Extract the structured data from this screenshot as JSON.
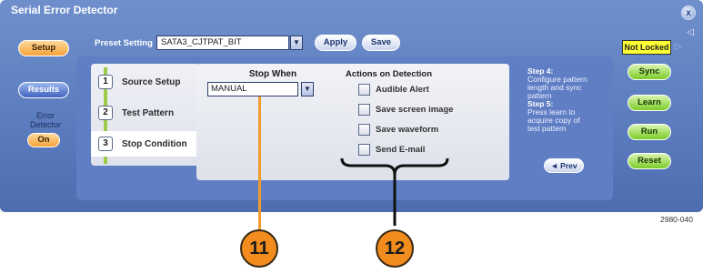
{
  "window": {
    "title": "Serial Error Detector",
    "close_glyph": "x"
  },
  "left_nav": {
    "setup_label": "Setup",
    "results_label": "Results",
    "error_detector_label": "Error Detector",
    "on_label": "On"
  },
  "preset": {
    "label": "Preset Setting",
    "value": "SATA3_CJTPAT_BIT",
    "apply_label": "Apply",
    "save_label": "Save"
  },
  "steps": [
    {
      "num": "1",
      "label": "Source Setup"
    },
    {
      "num": "2",
      "label": "Test Pattern"
    },
    {
      "num": "3",
      "label": "Stop Condition"
    }
  ],
  "stop_when": {
    "title": "Stop When",
    "value": "MANUAL"
  },
  "actions": {
    "title": "Actions on Detection",
    "items": [
      "Audible Alert",
      "Save screen image",
      "Save waveform",
      "Send E-mail"
    ]
  },
  "hint": {
    "step4_title": "Step 4:",
    "step4_text": "Configure pattern length and sync pattern",
    "step5_title": "Step 5:",
    "step5_text": "Press learn to acquire copy of test pattern",
    "prev_label": "◄ Prev"
  },
  "right_panel": {
    "status": "Not Locked",
    "sync_label": "Sync",
    "learn_label": "Learn",
    "run_label": "Run",
    "reset_label": "Reset"
  },
  "figure_code": "2980-040",
  "callouts": {
    "a": "11",
    "b": "12"
  },
  "colors": {
    "accent_orange": "#f28c1c",
    "status_yellow": "#ffff33",
    "window_blue": "#5a7bbd"
  }
}
